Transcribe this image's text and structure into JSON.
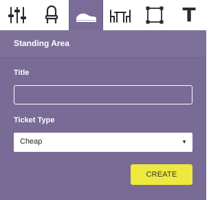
{
  "toolbar": {
    "tools": [
      {
        "icon": "sliders-icon",
        "active": false
      },
      {
        "icon": "chair-icon",
        "active": false
      },
      {
        "icon": "shoe-icon",
        "active": true
      },
      {
        "icon": "table-chairs-icon",
        "active": false
      },
      {
        "icon": "select-box-icon",
        "active": false
      },
      {
        "icon": "text-icon",
        "active": false,
        "glyph": "T"
      }
    ]
  },
  "panel": {
    "title": "Standing Area",
    "title_field": {
      "label": "Title",
      "value": "",
      "placeholder": ""
    },
    "ticket_type": {
      "label": "Ticket Type",
      "selected": "Cheap"
    },
    "create_label": "CREATE"
  },
  "colors": {
    "panel_bg": "#786b95",
    "button_bg": "#ede93f",
    "icon_dark": "#2b2b2b",
    "icon_active": "#ffffff"
  }
}
